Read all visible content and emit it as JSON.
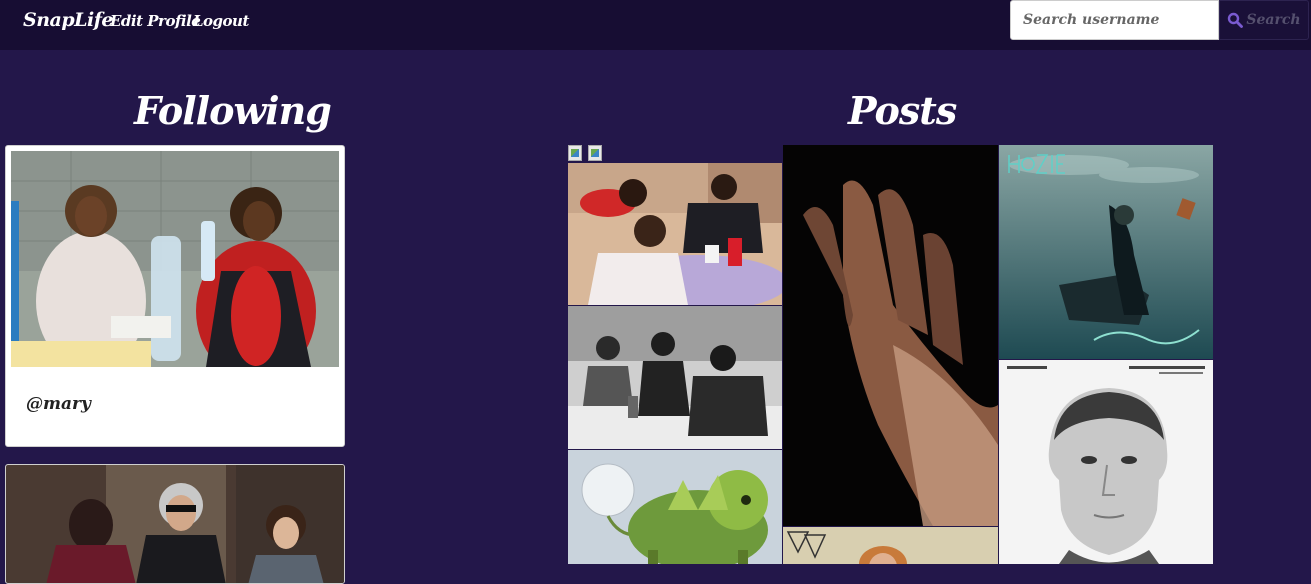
{
  "nav": {
    "brand": "SnapLife",
    "edit_profile": "Edit Profile",
    "logout": "Logout"
  },
  "search": {
    "placeholder": "Search username",
    "button_label": "Search"
  },
  "following": {
    "title": "Following",
    "users": [
      {
        "username": "@mary"
      }
    ]
  },
  "posts": {
    "title": "Posts"
  },
  "colors": {
    "background": "#23174a",
    "navbar": "#170d33",
    "accent": "#7a5bd0"
  }
}
